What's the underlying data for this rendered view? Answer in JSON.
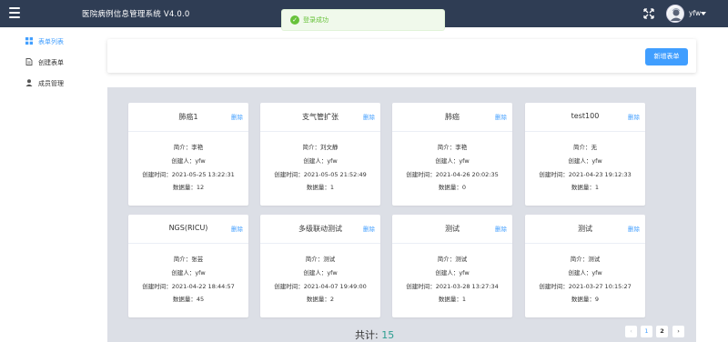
{
  "header": {
    "title": "医院病例信息管理系统   V4.0.0",
    "user_name": "yfw"
  },
  "toast": {
    "message": "登录成功",
    "check": "✓"
  },
  "sidebar": {
    "items": [
      {
        "label": "表单列表",
        "icon": "grid-icon",
        "active": true
      },
      {
        "label": "创建表单",
        "icon": "document-icon",
        "active": false
      },
      {
        "label": "成员管理",
        "icon": "user-icon",
        "active": false
      }
    ]
  },
  "toolbar": {
    "new_form_label": "新增表单"
  },
  "labels": {
    "delete": "删除"
  },
  "cards": [
    {
      "title": "肺癌1",
      "summary": "简介：李艳",
      "creator": "创建人：yfw",
      "created": "创建时间：2021-05-25 13:22:31",
      "count": "数据量：12"
    },
    {
      "title": "支气管扩张",
      "summary": "简介：刘文静",
      "creator": "创建人：yfw",
      "created": "创建时间：2021-05-05 21:52:49",
      "count": "数据量：1"
    },
    {
      "title": "肺癌",
      "summary": "简介：李艳",
      "creator": "创建人：yfw",
      "created": "创建时间：2021-04-26 20:02:35",
      "count": "数据量：0"
    },
    {
      "title": "test100",
      "summary": "简介：无",
      "creator": "创建人：yfw",
      "created": "创建时间：2021-04-23 19:12:33",
      "count": "数据量：1"
    },
    {
      "title": "NGS(RICU)",
      "summary": "简介：张芸",
      "creator": "创建人：yfw",
      "created": "创建时间：2021-04-22 18:44:57",
      "count": "数据量：45"
    },
    {
      "title": "多级联动测试",
      "summary": "简介：测试",
      "creator": "创建人：yfw",
      "created": "创建时间：2021-04-07 19:49:00",
      "count": "数据量：2"
    },
    {
      "title": "测试",
      "summary": "简介：测试",
      "creator": "创建人：yfw",
      "created": "创建时间：2021-03-28 13:27:34",
      "count": "数据量：1"
    },
    {
      "title": "测试",
      "summary": "简介：测试",
      "creator": "创建人：yfw",
      "created": "创建时间：2021-03-27 10:15:27",
      "count": "数据量：9"
    }
  ],
  "footer": {
    "total_label": "共计:",
    "total_value": "15"
  },
  "pagination": {
    "prev": "‹",
    "next": "›",
    "pages": [
      "1",
      "2"
    ],
    "current_page": "1"
  },
  "colors": {
    "header_bg": "#2f3d54",
    "accent": "#409eff",
    "success": "#67c23a",
    "panel_bg": "#dcdfe6",
    "total_value": "#2a9d8f"
  }
}
